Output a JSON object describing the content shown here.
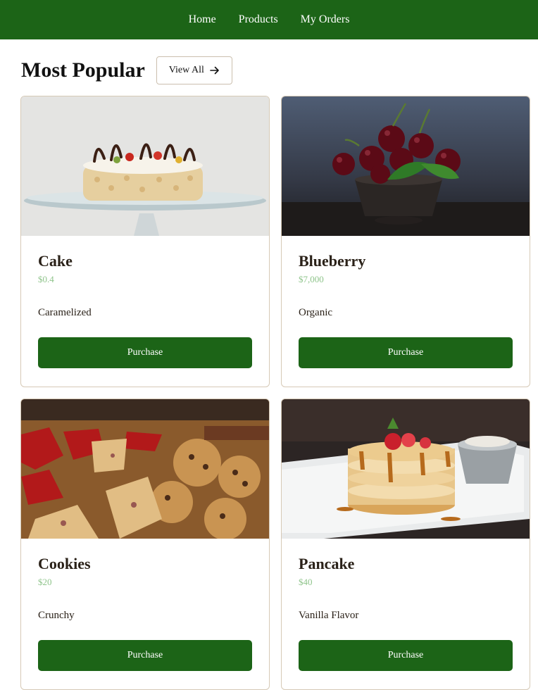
{
  "nav": {
    "items": [
      {
        "label": "Home"
      },
      {
        "label": "Products"
      },
      {
        "label": "My Orders"
      }
    ]
  },
  "section": {
    "title": "Most Popular",
    "view_all_label": "View All",
    "view_all_icon": "arrow-right-icon"
  },
  "products": [
    {
      "name": "Cake",
      "price": "$0.4",
      "description": "Caramelized",
      "button": "Purchase"
    },
    {
      "name": "Blueberry",
      "price": "$7,000",
      "description": "Organic",
      "button": "Purchase"
    },
    {
      "name": "Cookies",
      "price": "$20",
      "description": "Crunchy",
      "button": "Purchase"
    },
    {
      "name": "Pancake",
      "price": "$40",
      "description": "Vanilla Flavor",
      "button": "Purchase"
    }
  ],
  "colors": {
    "brand_green": "#1c6417",
    "price_green": "#8fc48b",
    "card_border": "#d6c9b6"
  }
}
